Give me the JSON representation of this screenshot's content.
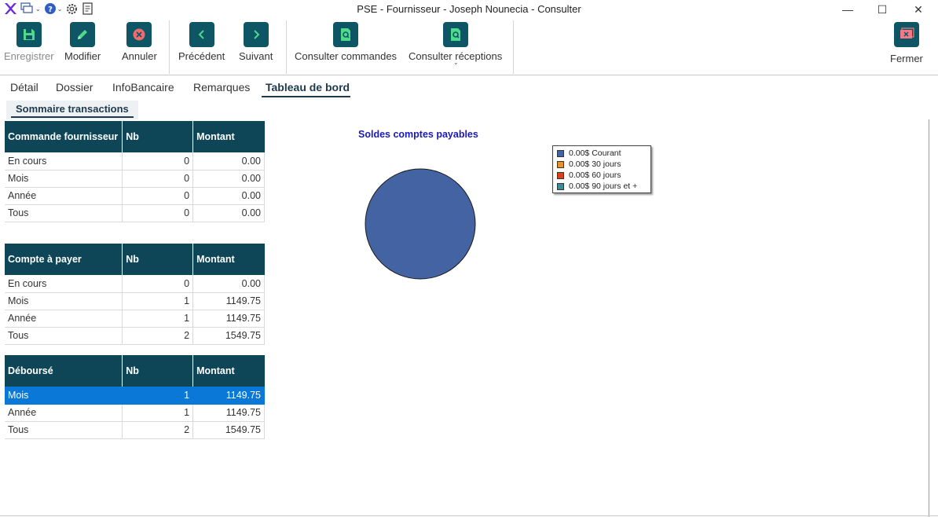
{
  "window": {
    "title": "PSE - Fournisseur - Joseph Nounecia - Consulter",
    "minimize_glyph": "—",
    "maximize_glyph": "☐",
    "close_glyph": "✕"
  },
  "quick_access": [
    "app-logo-icon",
    "windows-icon",
    "help-icon",
    "settings-icon",
    "document-icon"
  ],
  "ribbon": {
    "save": "Enregistrer",
    "edit": "Modifier",
    "cancel": "Annuler",
    "previous": "Précédent",
    "next": "Suivant",
    "view_orders": "Consulter commandes",
    "view_receipts": "Consulter réceptions",
    "close": "Fermer"
  },
  "tabs": [
    "Détail",
    "Dossier",
    "InfoBancaire",
    "Remarques",
    "Tableau de bord"
  ],
  "active_tab": "Tableau de bord",
  "subtab": "Sommaire transactions",
  "tables": {
    "commandes": {
      "headers": [
        "Commande fournisseur",
        "Nb",
        "Montant"
      ],
      "rows": [
        [
          "En cours",
          "0",
          "0.00"
        ],
        [
          "Mois",
          "0",
          "0.00"
        ],
        [
          "Année",
          "0",
          "0.00"
        ],
        [
          "Tous",
          "0",
          "0.00"
        ]
      ]
    },
    "comptes": {
      "headers": [
        "Compte à payer",
        "Nb",
        "Montant"
      ],
      "rows": [
        [
          "En cours",
          "0",
          "0.00"
        ],
        [
          "Mois",
          "1",
          "1149.75"
        ],
        [
          "Année",
          "1",
          "1149.75"
        ],
        [
          "Tous",
          "2",
          "1549.75"
        ]
      ]
    },
    "debourse": {
      "headers": [
        "Déboursé",
        "Nb",
        "Montant"
      ],
      "rows": [
        [
          "Mois",
          "1",
          "1149.75"
        ],
        [
          "Année",
          "1",
          "1149.75"
        ],
        [
          "Tous",
          "2",
          "1549.75"
        ]
      ],
      "selected_row": 0
    }
  },
  "chart_data": {
    "type": "pie",
    "title": "Soldes comptes payables",
    "legend_position": "top-right",
    "categories": [
      "0.00$ Courant",
      "0.00$ 30 jours",
      "0.00$ 60 jours",
      "0.00$ 90 jours et +"
    ],
    "values": [
      0,
      0,
      0,
      0
    ],
    "colors": [
      "#4463a3",
      "#e8922e",
      "#d9411b",
      "#3c8b97"
    ]
  }
}
